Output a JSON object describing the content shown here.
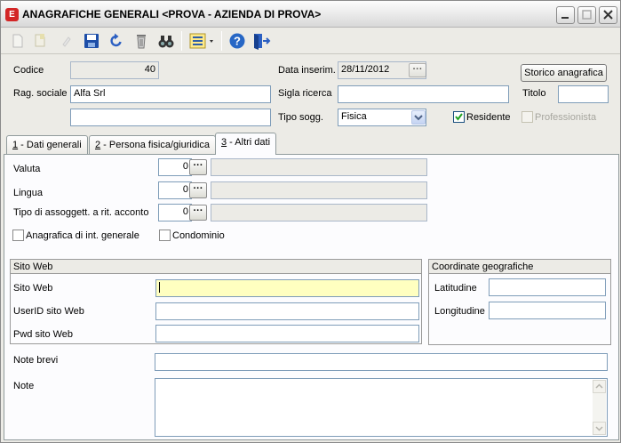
{
  "window": {
    "title": "ANAGRAFICHE GENERALI <PROVA - AZIENDA DI PROVA>",
    "app_icon_letter": "E"
  },
  "header": {
    "codice_label": "Codice",
    "codice_value": "40",
    "data_inserim_label": "Data inserim.",
    "data_inserim_value": "28/11/2012",
    "storico_button": "Storico anagrafica",
    "rag_sociale_label": "Rag. sociale",
    "rag_sociale_value": "Alfa Srl",
    "rag_sociale_2_value": "",
    "sigla_ricerca_label": "Sigla ricerca",
    "sigla_ricerca_value": "",
    "titolo_label": "Titolo",
    "titolo_value": "",
    "tipo_sogg_label": "Tipo sogg.",
    "tipo_sogg_value": "Fisica",
    "residente_label": "Residente",
    "residente_checked": true,
    "professionista_label": "Professionista",
    "professionista_checked": false
  },
  "tabs": [
    {
      "key": "1",
      "label": " - Dati generali"
    },
    {
      "key": "2",
      "label": " - Persona fisica/giuridica"
    },
    {
      "key": "3",
      "label": " - Altri dati"
    }
  ],
  "altri_dati": {
    "valuta_label": "Valuta",
    "valuta_value": "0",
    "lingua_label": "Lingua",
    "lingua_value": "0",
    "tipo_assog_label": "Tipo di assoggett. a rit. acconto",
    "tipo_assog_value": "0",
    "anagrafica_label": "Anagrafica di int. generale",
    "condominio_label": "Condominio",
    "sito_web_group": "Sito Web",
    "sito_web_label": "Sito Web",
    "userid_label": "UserID sito Web",
    "pwd_label": "Pwd sito Web",
    "coord_group": "Coordinate geografiche",
    "latitudine_label": "Latitudine",
    "longitudine_label": "Longitudine",
    "note_brevi_label": "Note brevi",
    "note_label": "Note"
  },
  "colors": {
    "focus_field": "#ffffc0",
    "window_bg": "#ecebe6"
  }
}
